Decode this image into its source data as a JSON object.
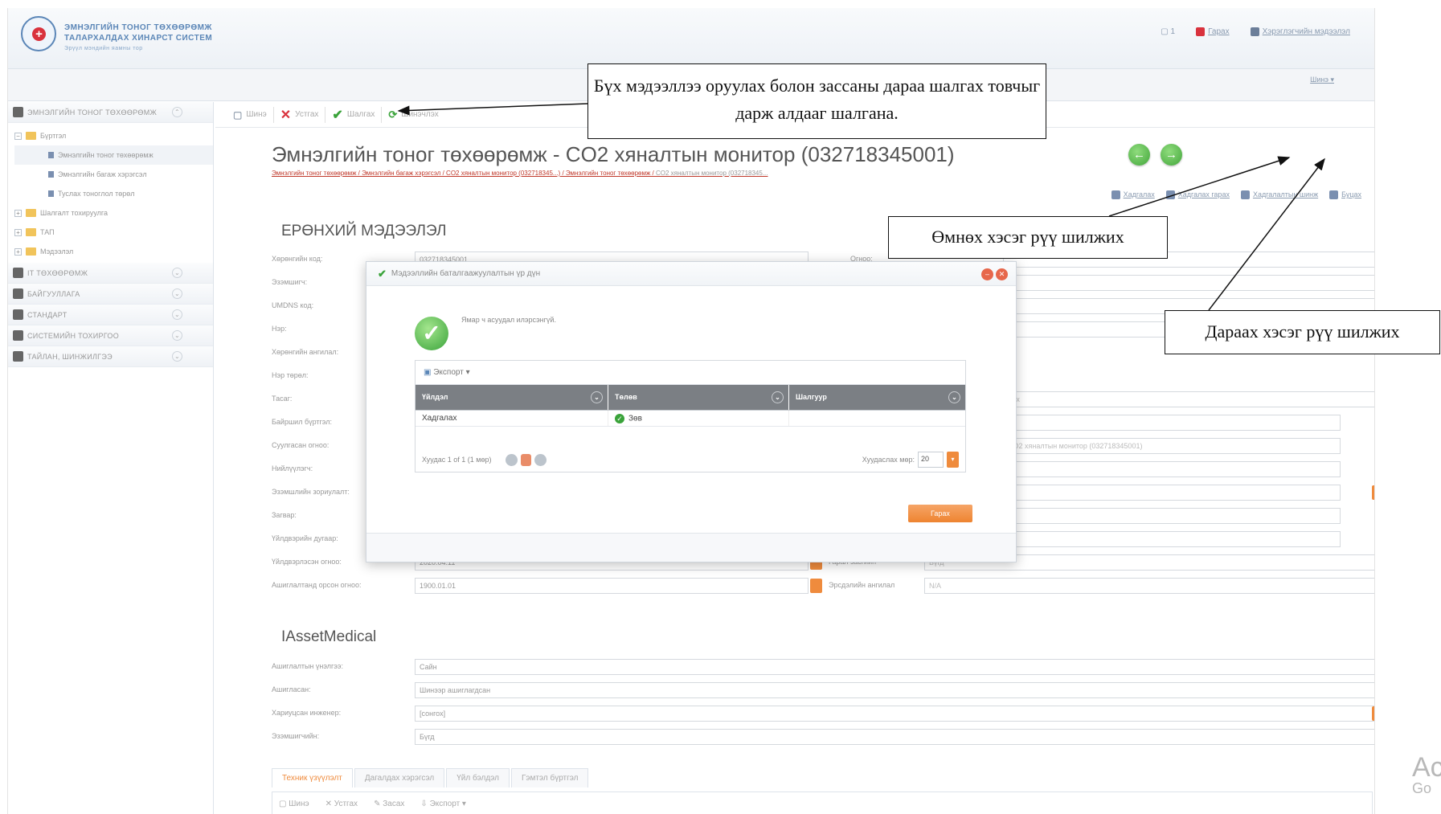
{
  "header": {
    "logo_line1": "ЭМНЭЛГИЙН ТОНОГ ТӨХӨӨРӨМЖ",
    "logo_line2": "ТАЛАРХАЛДАХ ХИНАРСТ СИСТЕМ",
    "logo_line3": "Эрүүл мэндийн яамны тор",
    "top_links": [
      "Гарах",
      "Хэрэглэгчийн мэдээлэл"
    ],
    "lang": "Шинэ"
  },
  "sidebar": {
    "root_group": "ЭМНЭЛГИЙН ТОНОГ ТӨХӨӨРӨМЖ",
    "tree": [
      {
        "label": "Бүртгэл",
        "level": 0
      },
      {
        "label": "Эмнэлгийн тоног төхөөрөмж",
        "level": 1
      },
      {
        "label": "Эмнэлгийн багаж хэрэгсэл",
        "level": 1
      },
      {
        "label": "Туслах тоноглол төрөл",
        "level": 1
      },
      {
        "label": "Шалгалт тохируулга",
        "level": 0
      },
      {
        "label": "ТАП",
        "level": 0
      },
      {
        "label": "Мэдээлэл",
        "level": 0
      }
    ],
    "groups": [
      "IT ТӨХӨӨРӨМЖ",
      "БАЙГУУЛЛАГА",
      "СТАНДАРТ",
      "СИСТЕМИЙН ТОХИРГОО",
      "ТАЙЛАН, ШИНЖИЛГЭЭ"
    ]
  },
  "toolbar": {
    "new": "Шинэ",
    "delete": "Устгах",
    "check": "Шалгах",
    "refresh": "Шинэчлэх"
  },
  "page": {
    "title": "Эмнэлгийн тоног төхөөрөмж - CO2 хяналтын монитор (032718345001)",
    "breadcrumbs": "Эмнэлгийн тоног төхөөрөмж / Эмнэлгийн багаж хэрэгсэл / CO2 хяналтын монитор (032718345...) / Эмнэлгийн тоног төхөөрөмж / ",
    "breadcrumb_last": "CO2 хяналтын монитор (032718345...",
    "actions": [
      "Хадгалах",
      "Хадгалах гарах",
      "Хадгалалтын шинж",
      "Буцах"
    ]
  },
  "form": {
    "section1": "ЕРӨНХИЙ МЭДЭЭЛЭЛ",
    "rows": [
      {
        "label": "Хөрөнгийн код:",
        "value": "032718345001",
        "right_label": "Огноо:"
      },
      {
        "label": "Эзэмшигч:",
        "value": "",
        "right_label": ""
      },
      {
        "label": "UMDNS код:",
        "value": "",
        "right_label": ""
      },
      {
        "label": "Нэр:",
        "value": "",
        "right_label": ""
      },
      {
        "label": "Хөрөнгийн ангилал:",
        "value": "",
        "right_label": ""
      },
      {
        "label": "Нэр төрөл:",
        "value": "",
        "right_label": ""
      },
      {
        "label": "Тасаг:",
        "value": "",
        "right_label": "",
        "right_value": "Бүх"
      },
      {
        "label": "Байршил бүртгэл:",
        "value": "",
        "right_label": ""
      },
      {
        "label": "Суулгасан огноо:",
        "value": "",
        "right_label": "",
        "right_value": "CO2 хяналтын монитор (032718345001)"
      },
      {
        "label": "Нийлүүлэгч:",
        "value": "",
        "right_label": ""
      },
      {
        "label": "Эзэмшлийн зориулалт:",
        "value": "",
        "right_label": ""
      },
      {
        "label": "Загвар:",
        "value": "",
        "right_label": ""
      },
      {
        "label": "Үйлдвэрийн дугаар:",
        "value": "",
        "right_label": ""
      },
      {
        "label": "Үйлдвэрлэсэн огноо:",
        "value": "2020.04.11",
        "right_label": "Гарал засгийн",
        "right_value": "Бүгд"
      },
      {
        "label": "Ашиглалтанд орсон огноо:",
        "value": "1900.01.01",
        "right_label": "Эрсдэлийн ангилал",
        "right_value": "N/A"
      }
    ],
    "section2": "IAssetMedical",
    "rows2": [
      {
        "label": "Ашиглалтын үнэлгээ:",
        "value": "Сайн"
      },
      {
        "label": "Ашигласан:",
        "value": "Шинээр ашиглагдсан"
      },
      {
        "label": "Хариуцсан инженер:",
        "value": "[сонгох]"
      },
      {
        "label": "Эзэмшигчийн:",
        "value": "Бүгд"
      }
    ]
  },
  "bottom_tabs": [
    "Техник үзүүлэлт",
    "Дагалдах хэрэгсэл",
    "Үйл бэлдэл",
    "Гэмтэл бүртгэл"
  ],
  "bottom_toolbar": [
    "Шинэ",
    "Устгах",
    "Засах",
    "Экспорт"
  ],
  "dialog": {
    "title": "Мэдээллийн баталгаажуулалтын үр дүн",
    "message": "Ямар ч асуудал илэрсэнгүй.",
    "export": "Экспорт",
    "columns": [
      "Үйлдэл",
      "Төлөв",
      "Шалгуур"
    ],
    "rows": [
      {
        "action": "Хадгалах",
        "status": "Зөв",
        "criteria": ""
      }
    ],
    "pager_text": "Хуудас 1 of 1 (1 мөр)",
    "page_size_label": "Хуудаслах мөр:",
    "page_size": "20",
    "close": "Гарах"
  },
  "annotations": {
    "check_note": "Бүх мэдээллээ оруулах болон зассаны дараа шалгах товчыг дарж алдааг шалгана.",
    "prev_note": "Өмнөх хэсэг рүү шилжих",
    "next_note": "Дараах хэсэг рүү шилжих"
  },
  "watermark": {
    "line1": "Ac",
    "line2": "Go"
  }
}
